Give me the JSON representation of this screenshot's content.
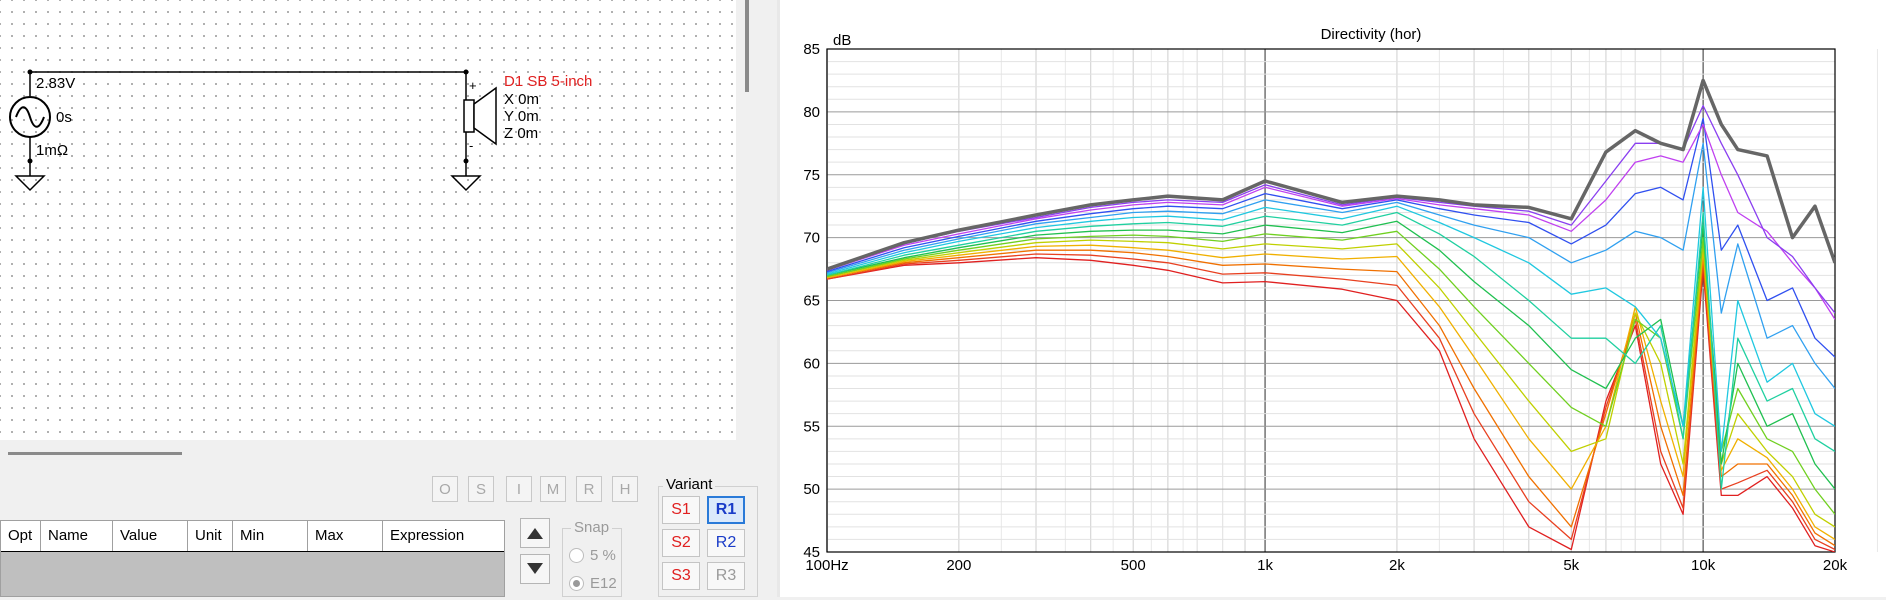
{
  "schematic": {
    "source": {
      "voltage": "2.83V",
      "delay": "0s",
      "resistance": "1mΩ"
    },
    "driver": {
      "name": "D1 SB 5-inch",
      "x": "X 0m",
      "y": "Y 0m",
      "z": "Z 0m",
      "plus": "+",
      "minus": "-"
    }
  },
  "toolbar": {
    "buttons": [
      "O",
      "S",
      "I",
      "M",
      "R",
      "H"
    ]
  },
  "param_grid": {
    "columns": [
      "Opt",
      "Name",
      "Value",
      "Unit",
      "Min",
      "Max",
      "Expression"
    ]
  },
  "nav": {
    "up_icon": "triangle-up-icon",
    "down_icon": "triangle-down-icon"
  },
  "snap": {
    "title": "Snap",
    "options": [
      "5 %",
      "E12"
    ],
    "selected": "E12"
  },
  "variant": {
    "title": "Variant",
    "s_buttons": [
      "S1",
      "S2",
      "S3"
    ],
    "r_buttons": [
      "R1",
      "R2",
      "R3"
    ],
    "selected": "R1"
  },
  "colors": {
    "source_label": "#000000",
    "driver_label": "#e02020",
    "sel_border": "#2a7ad8",
    "on_axis": "#666666"
  },
  "chart_data": {
    "type": "line",
    "title": "Directivity (hor)",
    "ylabel": "dB",
    "xscale": "log",
    "xlim": [
      100,
      20000
    ],
    "ylim": [
      45,
      85
    ],
    "grid": true,
    "x_ticks": [
      {
        "v": 100,
        "label": "100Hz"
      },
      {
        "v": 200,
        "label": "200"
      },
      {
        "v": 500,
        "label": "500"
      },
      {
        "v": 1000,
        "label": "1k"
      },
      {
        "v": 2000,
        "label": "2k"
      },
      {
        "v": 5000,
        "label": "5k"
      },
      {
        "v": 10000,
        "label": "10k"
      },
      {
        "v": 20000,
        "label": "20k"
      }
    ],
    "y_ticks": [
      45,
      50,
      55,
      60,
      65,
      70,
      75,
      80,
      85
    ],
    "freqs": [
      100,
      150,
      200,
      300,
      400,
      500,
      600,
      800,
      1000,
      1500,
      2000,
      2500,
      3000,
      4000,
      5000,
      6000,
      7000,
      8000,
      9000,
      10000,
      11000,
      12000,
      14000,
      16000,
      18000,
      20000
    ],
    "series": [
      {
        "color": "#666666",
        "width": 3.5,
        "values": [
          67.5,
          69.6,
          70.6,
          71.8,
          72.6,
          73.0,
          73.3,
          73.0,
          74.5,
          72.8,
          73.3,
          73.0,
          72.6,
          72.4,
          71.5,
          76.8,
          78.5,
          77.5,
          77.0,
          82.5,
          79.0,
          77.0,
          76.5,
          70.0,
          72.5,
          68.0
        ]
      },
      {
        "color": "#8a3ff0",
        "width": 1.3,
        "values": [
          67.5,
          69.5,
          70.5,
          71.6,
          72.4,
          72.8,
          73.0,
          72.8,
          74.2,
          72.6,
          73.2,
          72.8,
          72.5,
          72.1,
          71.0,
          74.5,
          77.5,
          77.5,
          77.0,
          80.5,
          77.5,
          75.0,
          70.0,
          68.5,
          66.0,
          64.0
        ]
      },
      {
        "color": "#c040f0",
        "width": 1.3,
        "values": [
          67.4,
          69.4,
          70.3,
          71.5,
          72.2,
          72.6,
          72.8,
          72.6,
          74.0,
          72.5,
          73.1,
          72.6,
          72.3,
          71.8,
          70.5,
          73.0,
          76.0,
          76.5,
          76.0,
          79.0,
          75.0,
          72.0,
          70.5,
          68.0,
          66.0,
          63.5
        ]
      },
      {
        "color": "#3050f0",
        "width": 1.3,
        "values": [
          67.3,
          69.2,
          70.1,
          71.3,
          71.9,
          72.3,
          72.5,
          72.3,
          73.5,
          72.3,
          73.0,
          72.3,
          71.8,
          71.2,
          69.5,
          71.0,
          73.5,
          74.0,
          73.0,
          79.5,
          69.0,
          71.0,
          65.0,
          66.0,
          62.0,
          60.5
        ]
      },
      {
        "color": "#30a0f0",
        "width": 1.3,
        "values": [
          67.2,
          69.0,
          69.9,
          71.1,
          71.6,
          72.0,
          72.1,
          71.9,
          73.0,
          72.0,
          72.8,
          71.8,
          71.0,
          70.0,
          68.0,
          69.0,
          70.5,
          70.0,
          69.0,
          77.5,
          64.0,
          69.5,
          62.0,
          63.0,
          60.0,
          58.0
        ]
      },
      {
        "color": "#20c8e0",
        "width": 1.3,
        "values": [
          67.1,
          68.8,
          69.7,
          70.8,
          71.3,
          71.6,
          71.7,
          71.4,
          72.4,
          71.5,
          72.5,
          71.2,
          70.0,
          68.0,
          65.5,
          66.0,
          64.5,
          62.0,
          55.0,
          74.0,
          53.0,
          65.0,
          58.5,
          60.0,
          56.0,
          55.0
        ]
      },
      {
        "color": "#20d0a0",
        "width": 1.3,
        "values": [
          67.0,
          68.6,
          69.4,
          70.5,
          70.9,
          71.1,
          71.2,
          70.9,
          71.7,
          71.0,
          72.0,
          70.3,
          68.5,
          65.0,
          62.0,
          62.0,
          60.0,
          63.0,
          54.0,
          72.0,
          50.0,
          62.0,
          57.0,
          58.0,
          54.0,
          53.0
        ]
      },
      {
        "color": "#20c050",
        "width": 1.3,
        "values": [
          67.0,
          68.4,
          69.2,
          70.2,
          70.5,
          70.6,
          70.6,
          70.3,
          71.0,
          70.4,
          71.3,
          69.0,
          66.5,
          63.0,
          59.5,
          58.0,
          62.0,
          63.5,
          55.0,
          71.0,
          52.0,
          60.0,
          55.0,
          56.0,
          52.0,
          50.0
        ]
      },
      {
        "color": "#70d020",
        "width": 1.3,
        "values": [
          66.9,
          68.3,
          69.0,
          69.9,
          70.1,
          70.2,
          70.1,
          69.7,
          70.3,
          69.8,
          70.5,
          67.5,
          64.5,
          60.0,
          56.5,
          55.0,
          63.5,
          62.0,
          54.0,
          70.0,
          53.0,
          58.0,
          54.0,
          53.0,
          50.0,
          48.0
        ]
      },
      {
        "color": "#c0d000",
        "width": 1.3,
        "values": [
          66.9,
          68.2,
          68.8,
          69.6,
          69.8,
          69.7,
          69.6,
          69.1,
          69.5,
          69.1,
          69.5,
          66.0,
          62.5,
          57.0,
          53.0,
          54.0,
          64.0,
          60.0,
          52.0,
          69.5,
          52.0,
          56.0,
          53.0,
          51.0,
          48.0,
          47.0
        ]
      },
      {
        "color": "#f0b000",
        "width": 1.3,
        "values": [
          66.8,
          68.1,
          68.6,
          69.3,
          69.4,
          69.2,
          69.0,
          68.4,
          68.7,
          68.3,
          68.5,
          64.5,
          60.5,
          54.0,
          50.0,
          55.0,
          64.5,
          57.0,
          51.0,
          69.0,
          51.5,
          54.0,
          52.5,
          50.0,
          47.0,
          46.0
        ]
      },
      {
        "color": "#f07000",
        "width": 1.3,
        "values": [
          66.8,
          68.0,
          68.4,
          69.0,
          69.0,
          68.8,
          68.5,
          67.8,
          67.9,
          67.5,
          67.3,
          63.0,
          58.0,
          51.0,
          47.0,
          56.0,
          64.0,
          55.0,
          49.5,
          68.5,
          51.0,
          52.0,
          52.0,
          49.5,
          46.5,
          45.5
        ]
      },
      {
        "color": "#e84020",
        "width": 1.3,
        "values": [
          66.7,
          67.9,
          68.2,
          68.7,
          68.6,
          68.3,
          68.0,
          67.1,
          67.2,
          66.7,
          66.2,
          62.0,
          56.0,
          49.0,
          46.0,
          56.5,
          63.5,
          53.0,
          48.5,
          68.0,
          50.0,
          50.5,
          51.5,
          49.0,
          46.0,
          45.2
        ]
      },
      {
        "color": "#e02020",
        "width": 1.3,
        "values": [
          66.7,
          67.8,
          68.0,
          68.4,
          68.2,
          67.8,
          67.4,
          66.4,
          66.5,
          65.9,
          65.0,
          61.0,
          54.0,
          47.0,
          45.2,
          57.0,
          63.0,
          52.0,
          48.0,
          67.5,
          49.5,
          49.5,
          51.0,
          48.5,
          45.5,
          45.0
        ]
      }
    ]
  }
}
